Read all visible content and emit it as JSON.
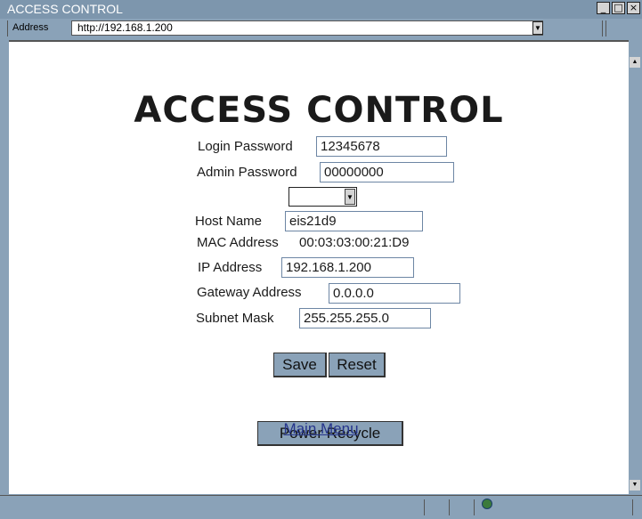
{
  "window": {
    "title": "ACCESS CONTROL"
  },
  "address_bar": {
    "label": "Address",
    "url": "http://192.168.1.200"
  },
  "page": {
    "heading": "ACCESS CONTROL",
    "fields": {
      "login_password": {
        "label": "Login Password",
        "value": "12345678"
      },
      "admin_password": {
        "label": "Admin Password",
        "value": "00000000"
      },
      "host_name": {
        "label": "Host Name",
        "value": "eis21d9"
      },
      "mac_address": {
        "label": "MAC Address",
        "value": "00:03:03:00:21:D9"
      },
      "ip_address": {
        "label": "IP Address",
        "value": "192.168.1.200"
      },
      "gateway_address": {
        "label": "Gateway Address",
        "value": "0.0.0.0"
      },
      "subnet_mask": {
        "label": "Subnet Mask",
        "value": "255.255.255.0"
      }
    },
    "select_value": "",
    "buttons": {
      "save": "Save",
      "reset": "Reset",
      "power_recycle": "Power Recycle"
    },
    "main_menu_link": "Main Menu"
  }
}
